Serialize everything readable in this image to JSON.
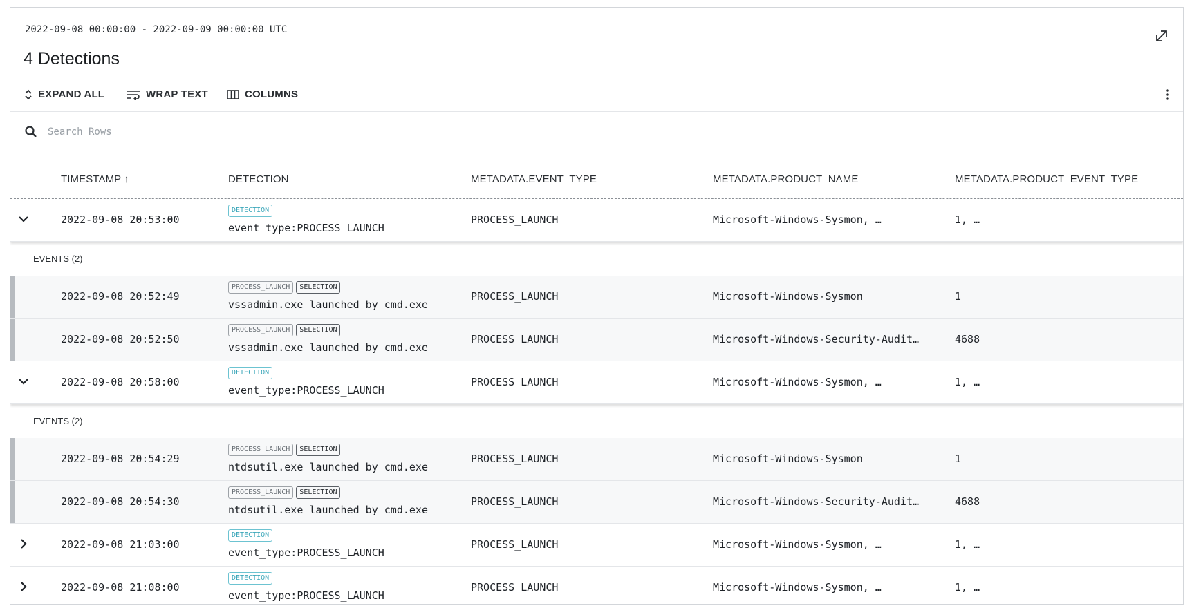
{
  "header": {
    "range": "2022-09-08 00:00:00 - 2022-09-09 00:00:00 UTC",
    "title": "4 Detections"
  },
  "toolbar": {
    "expand_all": "EXPAND ALL",
    "wrap_text": "WRAP TEXT",
    "columns": "COLUMNS"
  },
  "search": {
    "placeholder": "Search Rows"
  },
  "columns": [
    "TIMESTAMP ↑",
    "DETECTION",
    "METADATA.EVENT_TYPE",
    "METADATA.PRODUCT_NAME",
    "METADATA.PRODUCT_EVENT_TYPE"
  ],
  "detections": [
    {
      "timestamp": "2022-09-08 20:53:00",
      "tag": "DETECTION",
      "text": "event_type:PROCESS_LAUNCH",
      "event_type": "PROCESS_LAUNCH",
      "product_name": "Microsoft-Windows-Sysmon, …",
      "product_event_type": "1, …",
      "events_label": "EVENTS (2)",
      "events": [
        {
          "timestamp": "2022-09-08 20:52:49",
          "tags": [
            "PROCESS_LAUNCH",
            "SELECTION"
          ],
          "text": "vssadmin.exe launched by cmd.exe",
          "event_type": "PROCESS_LAUNCH",
          "product_name": "Microsoft-Windows-Sysmon",
          "product_event_type": "1"
        },
        {
          "timestamp": "2022-09-08 20:52:50",
          "tags": [
            "PROCESS_LAUNCH",
            "SELECTION"
          ],
          "text": "vssadmin.exe launched by cmd.exe",
          "event_type": "PROCESS_LAUNCH",
          "product_name": "Microsoft-Windows-Security-Audit…",
          "product_event_type": "4688"
        }
      ]
    },
    {
      "timestamp": "2022-09-08 20:58:00",
      "tag": "DETECTION",
      "text": "event_type:PROCESS_LAUNCH",
      "event_type": "PROCESS_LAUNCH",
      "product_name": "Microsoft-Windows-Sysmon, …",
      "product_event_type": "1, …",
      "events_label": "EVENTS (2)",
      "events": [
        {
          "timestamp": "2022-09-08 20:54:29",
          "tags": [
            "PROCESS_LAUNCH",
            "SELECTION"
          ],
          "text": "ntdsutil.exe launched by cmd.exe",
          "event_type": "PROCESS_LAUNCH",
          "product_name": "Microsoft-Windows-Sysmon",
          "product_event_type": "1"
        },
        {
          "timestamp": "2022-09-08 20:54:30",
          "tags": [
            "PROCESS_LAUNCH",
            "SELECTION"
          ],
          "text": "ntdsutil.exe launched by cmd.exe",
          "event_type": "PROCESS_LAUNCH",
          "product_name": "Microsoft-Windows-Security-Audit…",
          "product_event_type": "4688"
        }
      ]
    },
    {
      "timestamp": "2022-09-08 21:03:00",
      "tag": "DETECTION",
      "text": "event_type:PROCESS_LAUNCH",
      "event_type": "PROCESS_LAUNCH",
      "product_name": "Microsoft-Windows-Sysmon, …",
      "product_event_type": "1, …"
    },
    {
      "timestamp": "2022-09-08 21:08:00",
      "tag": "DETECTION",
      "text": "event_type:PROCESS_LAUNCH",
      "event_type": "PROCESS_LAUNCH",
      "product_name": "Microsoft-Windows-Sysmon, …",
      "product_event_type": "1, …"
    }
  ],
  "colors": {
    "detection_tag": "#3aa6b9",
    "event_bar": "#b7bbc0",
    "text": "#1f2328"
  },
  "icons": [
    "expand-icon",
    "sort-icon",
    "wrap-icon",
    "columns-icon",
    "kebab-icon",
    "search-icon",
    "chevron-down-icon",
    "chevron-right-icon"
  ]
}
